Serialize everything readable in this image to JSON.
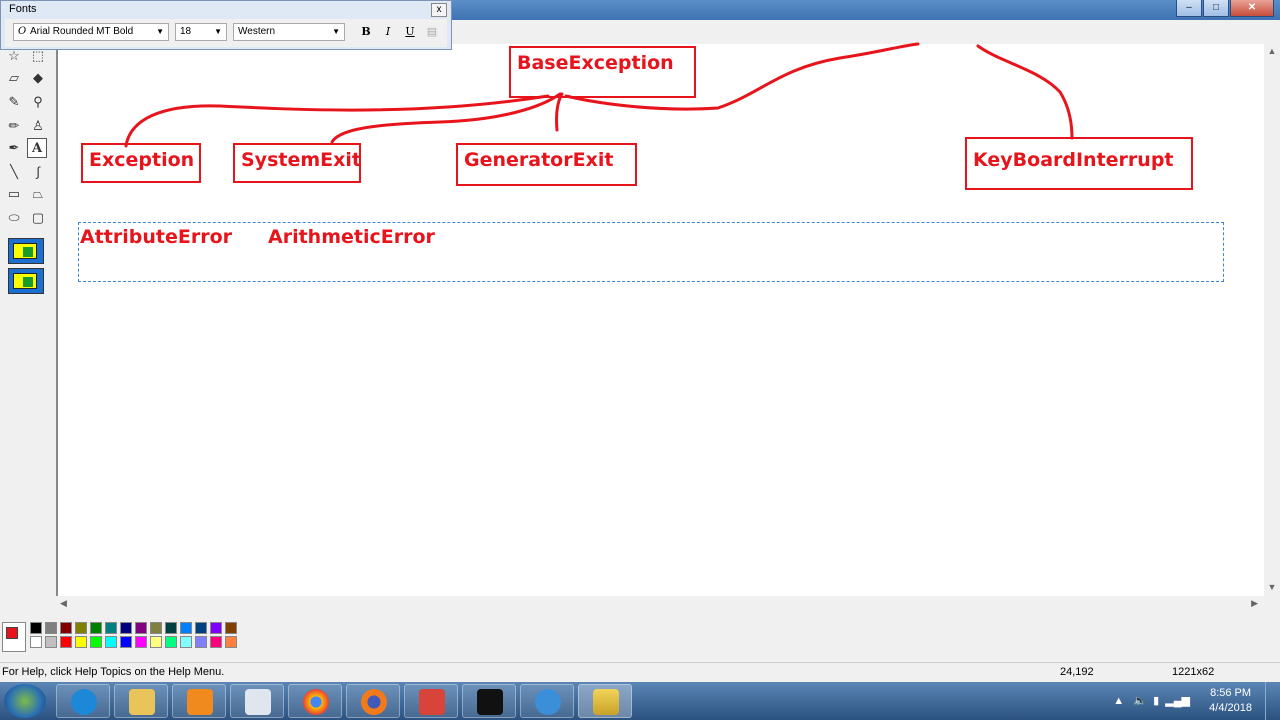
{
  "fonts_toolbar": {
    "title": "Fonts",
    "font_name": "Arial Rounded MT Bold",
    "font_size": "18",
    "script": "Western",
    "bold": "B",
    "italic": "I",
    "underline": "U",
    "close": "x"
  },
  "diagram": {
    "root": "BaseException",
    "children": [
      "Exception",
      "SystemExit",
      "GeneratorExit",
      "KeyBoardInterrupt"
    ],
    "text_line": [
      "AttributeError",
      "ArithmeticError"
    ]
  },
  "status_bar": {
    "help_text": "For Help, click Help Topics on the Help Menu.",
    "cursor_position": "24,192",
    "selection_size": "1221x62"
  },
  "taskbar": {
    "time": "8:56 PM",
    "date": "4/4/2018"
  },
  "palette_colors": [
    "#000000",
    "#808080",
    "#800000",
    "#808000",
    "#008000",
    "#008080",
    "#000080",
    "#800080",
    "#808040",
    "#004040",
    "#0080ff",
    "#004080",
    "#8000ff",
    "#804000",
    "#ffffff",
    "#c0c0c0",
    "#ff0000",
    "#ffff00",
    "#00ff00",
    "#00ffff",
    "#0000ff",
    "#ff00ff",
    "#ffff80",
    "#00ff80",
    "#80ffff",
    "#8080ff",
    "#ff0080",
    "#ff8040"
  ],
  "accent_color": "#e8141c"
}
